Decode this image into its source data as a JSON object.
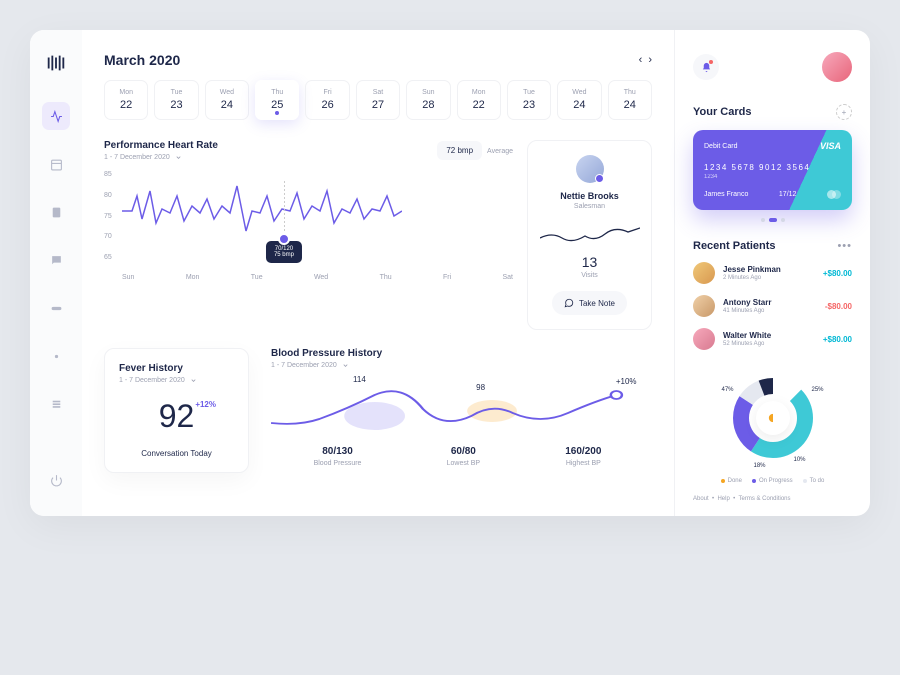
{
  "header": {
    "title": "March 2020"
  },
  "calendar": [
    {
      "label": "Mon",
      "num": "22"
    },
    {
      "label": "Tue",
      "num": "23"
    },
    {
      "label": "Wed",
      "num": "24"
    },
    {
      "label": "Thu",
      "num": "25"
    },
    {
      "label": "Fri",
      "num": "26"
    },
    {
      "label": "Sat",
      "num": "27"
    },
    {
      "label": "Sun",
      "num": "28"
    },
    {
      "label": "Mon",
      "num": "22"
    },
    {
      "label": "Tue",
      "num": "23"
    },
    {
      "label": "Wed",
      "num": "24"
    },
    {
      "label": "Thu",
      "num": "24"
    }
  ],
  "heart": {
    "title": "Performance Heart Rate",
    "range": "1 - 7 December 2020",
    "badge": "72 bmp",
    "avg": "Average",
    "tooltip": {
      "line1": "70/120",
      "line2": "75 bmp"
    }
  },
  "profile": {
    "name": "Nettie Brooks",
    "role": "Salesman",
    "visits": "13",
    "visitsLabel": "Visits",
    "button": "Take Note"
  },
  "fever": {
    "title": "Fever History",
    "range": "1 - 7 December 2020",
    "value": "92",
    "change": "+12%",
    "caption": "Conversation Today"
  },
  "bp": {
    "title": "Blood Pressure History",
    "range": "1 - 7 December 2020",
    "peak1": "114",
    "peak2": "98",
    "change": "+10%",
    "items": [
      {
        "val": "80/130",
        "lbl": "Blood Pressure"
      },
      {
        "val": "60/80",
        "lbl": "Lowest BP"
      },
      {
        "val": "160/200",
        "lbl": "Highest BP"
      }
    ]
  },
  "cards": {
    "title": "Your Cards",
    "type": "Debit Card",
    "brand": "VISA",
    "num": "1234   5678   9012   3564",
    "num2": "1234",
    "holder": "James Franco",
    "exp": "17/12"
  },
  "patients": {
    "title": "Recent Patients",
    "list": [
      {
        "name": "Jesse Pinkman",
        "time": "2 Minutes Ago",
        "amount": "+$80.00",
        "cls": "positive",
        "bg": "linear-gradient(135deg,#f0c878,#d89850)"
      },
      {
        "name": "Antony Starr",
        "time": "41 Minutes Ago",
        "amount": "-$80.00",
        "cls": "negative",
        "bg": "linear-gradient(135deg,#f0d0a8,#c89868)"
      },
      {
        "name": "Walter White",
        "time": "52 Minutes Ago",
        "amount": "+$80.00",
        "cls": "positive",
        "bg": "linear-gradient(135deg,#f7a9bc,#d87a90)"
      }
    ]
  },
  "donut": {
    "labels": [
      "47%",
      "25%",
      "10%",
      "18%"
    ],
    "legend": [
      "Done",
      "On Progress",
      "To do"
    ]
  },
  "footer": {
    "a": "About",
    "b": "Help",
    "c": "Terms & Conditions"
  },
  "chart_data": {
    "heart_rate": {
      "type": "line",
      "ylabels": [
        "85",
        "80",
        "75",
        "70",
        "65"
      ],
      "xlabels": [
        "Sun",
        "Mon",
        "Tue",
        "Wed",
        "Thu",
        "Fri",
        "Sat"
      ],
      "ylim": [
        65,
        85
      ],
      "tooltip": {
        "bp": "70/120",
        "bpm": 75
      },
      "average_bpm": 72
    },
    "blood_pressure": {
      "type": "line",
      "peaks": [
        114,
        98
      ],
      "change_pct": 10,
      "stats": [
        {
          "label": "Blood Pressure",
          "value": "80/130"
        },
        {
          "label": "Lowest BP",
          "value": "60/80"
        },
        {
          "label": "Highest BP",
          "value": "160/200"
        }
      ]
    },
    "donut": {
      "type": "pie",
      "series": [
        {
          "name": "Done",
          "value": 47
        },
        {
          "name": "On Progress",
          "value": 25
        },
        {
          "name": "To do",
          "value": 10
        },
        {
          "name": "",
          "value": 18
        }
      ]
    }
  }
}
